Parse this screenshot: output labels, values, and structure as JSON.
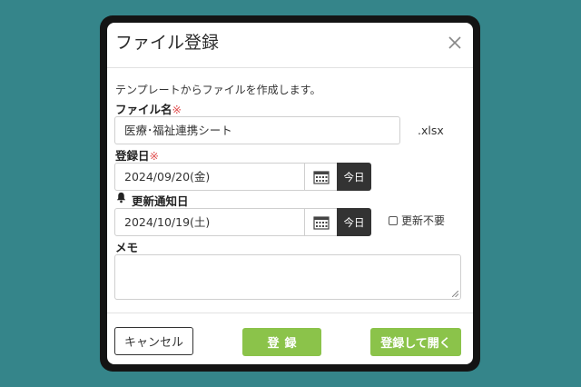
{
  "dialog": {
    "title": "ファイル登録",
    "description": "テンプレートからファイルを作成します。"
  },
  "file_name": {
    "label": "ファイル名",
    "required_mark": "※",
    "value": "医療･福祉連携シート",
    "extension": ".xlsx"
  },
  "register_date": {
    "label": "登録日",
    "required_mark": "※",
    "value": "2024/09/20(金)",
    "today_label": "今日"
  },
  "renewal_date": {
    "label": "更新通知日",
    "value": "2024/10/19(土)",
    "today_label": "今日",
    "no_renewal_label": "更新不要"
  },
  "memo": {
    "label": "メモ",
    "value": ""
  },
  "footer": {
    "cancel_label": "キャンセル",
    "register_label": "登録",
    "register_open_label": "登録して開く"
  },
  "colors": {
    "background": "#35858a",
    "accent_green": "#8bc34a",
    "dark_button": "#333333",
    "required": "#e05050"
  }
}
